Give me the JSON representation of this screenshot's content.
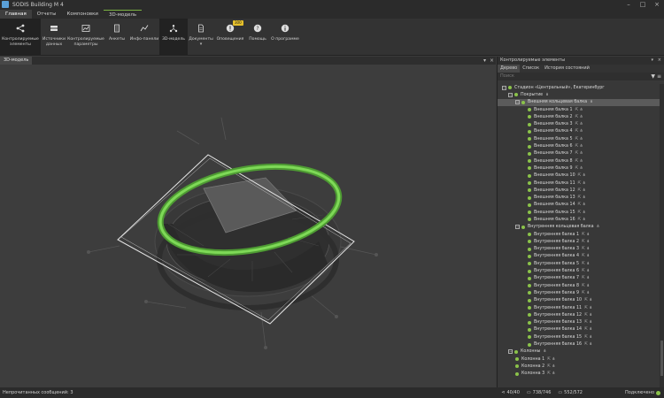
{
  "window": {
    "title": "SODIS Building M 4"
  },
  "menu_tabs": [
    "Главная",
    "Отчеты",
    "Компоновки",
    "3D-модель"
  ],
  "ribbon": [
    {
      "label": "Контролируемые элементы",
      "icon": "share-icon"
    },
    {
      "label": "Источники данных",
      "icon": "database-icon"
    },
    {
      "label": "Контролируемые параметры",
      "icon": "chart-icon"
    },
    {
      "label": "Анкеты",
      "icon": "form-icon"
    },
    {
      "label": "Инфо-панели",
      "icon": "trend-icon"
    },
    {
      "label": "3D-модель",
      "icon": "model-icon"
    },
    {
      "label": "Документы",
      "icon": "document-icon"
    },
    {
      "label": "Оповещения",
      "icon": "alert-icon",
      "badge": "300"
    },
    {
      "label": "Помощь",
      "icon": "help-icon"
    },
    {
      "label": "О программе",
      "icon": "info-icon"
    }
  ],
  "left_pane": {
    "tab": "3D-модель"
  },
  "right_pane": {
    "title": "Контролируемые элементы",
    "tabs": [
      "Дерево",
      "Список",
      "История состояний"
    ],
    "search_placeholder": "Поиск",
    "tree": [
      {
        "label": "Стадион «Центральный», Екатеринбург",
        "level": 0,
        "exp": "−"
      },
      {
        "label": "Покрытие",
        "level": 1,
        "exp": "−"
      },
      {
        "label": "Внешняя кольцевая балка",
        "level": 2,
        "exp": "−",
        "selected": true
      },
      {
        "label": "Внешняя балка 1",
        "level": 3
      },
      {
        "label": "Внешняя балка 2",
        "level": 3
      },
      {
        "label": "Внешняя балка 3",
        "level": 3
      },
      {
        "label": "Внешняя балка 4",
        "level": 3
      },
      {
        "label": "Внешняя балка 5",
        "level": 3
      },
      {
        "label": "Внешняя балка 6",
        "level": 3
      },
      {
        "label": "Внешняя балка 7",
        "level": 3
      },
      {
        "label": "Внешняя балка 8",
        "level": 3
      },
      {
        "label": "Внешняя балка 9",
        "level": 3
      },
      {
        "label": "Внешняя балка 10",
        "level": 3
      },
      {
        "label": "Внешняя балка 11",
        "level": 3
      },
      {
        "label": "Внешняя балка 12",
        "level": 3
      },
      {
        "label": "Внешняя балка 13",
        "level": 3
      },
      {
        "label": "Внешняя балка 14",
        "level": 3
      },
      {
        "label": "Внешняя балка 15",
        "level": 3
      },
      {
        "label": "Внешняя балка 16",
        "level": 3
      },
      {
        "label": "Внутренняя кольцевая балка",
        "level": 2,
        "exp": "−"
      },
      {
        "label": "Внутренняя балка 1",
        "level": 3
      },
      {
        "label": "Внутренняя балка 2",
        "level": 3
      },
      {
        "label": "Внутренняя балка 3",
        "level": 3
      },
      {
        "label": "Внутренняя балка 4",
        "level": 3
      },
      {
        "label": "Внутренняя балка 5",
        "level": 3
      },
      {
        "label": "Внутренняя балка 6",
        "level": 3
      },
      {
        "label": "Внутренняя балка 7",
        "level": 3
      },
      {
        "label": "Внутренняя балка 8",
        "level": 3
      },
      {
        "label": "Внутренняя балка 9",
        "level": 3
      },
      {
        "label": "Внутренняя балка 10",
        "level": 3
      },
      {
        "label": "Внутренняя балка 11",
        "level": 3
      },
      {
        "label": "Внутренняя балка 12",
        "level": 3
      },
      {
        "label": "Внутренняя балка 13",
        "level": 3
      },
      {
        "label": "Внутренняя балка 14",
        "level": 3
      },
      {
        "label": "Внутренняя балка 15",
        "level": 3
      },
      {
        "label": "Внутренняя балка 16",
        "level": 3
      },
      {
        "label": "Колонны",
        "level": 1,
        "exp": "−"
      },
      {
        "label": "Колонна 1",
        "level": 2
      },
      {
        "label": "Колонна 2",
        "level": 2
      },
      {
        "label": "Колонна 3",
        "level": 2
      }
    ]
  },
  "status": {
    "left": "Непрочитанных сообщений: 3",
    "coords": "40/40",
    "mem1": "738/746",
    "mem2": "552/572",
    "connection": "Подключено"
  },
  "colors": {
    "accent": "#8bc34a",
    "ring": "#6ab04c",
    "badge": "#e6c02a"
  }
}
